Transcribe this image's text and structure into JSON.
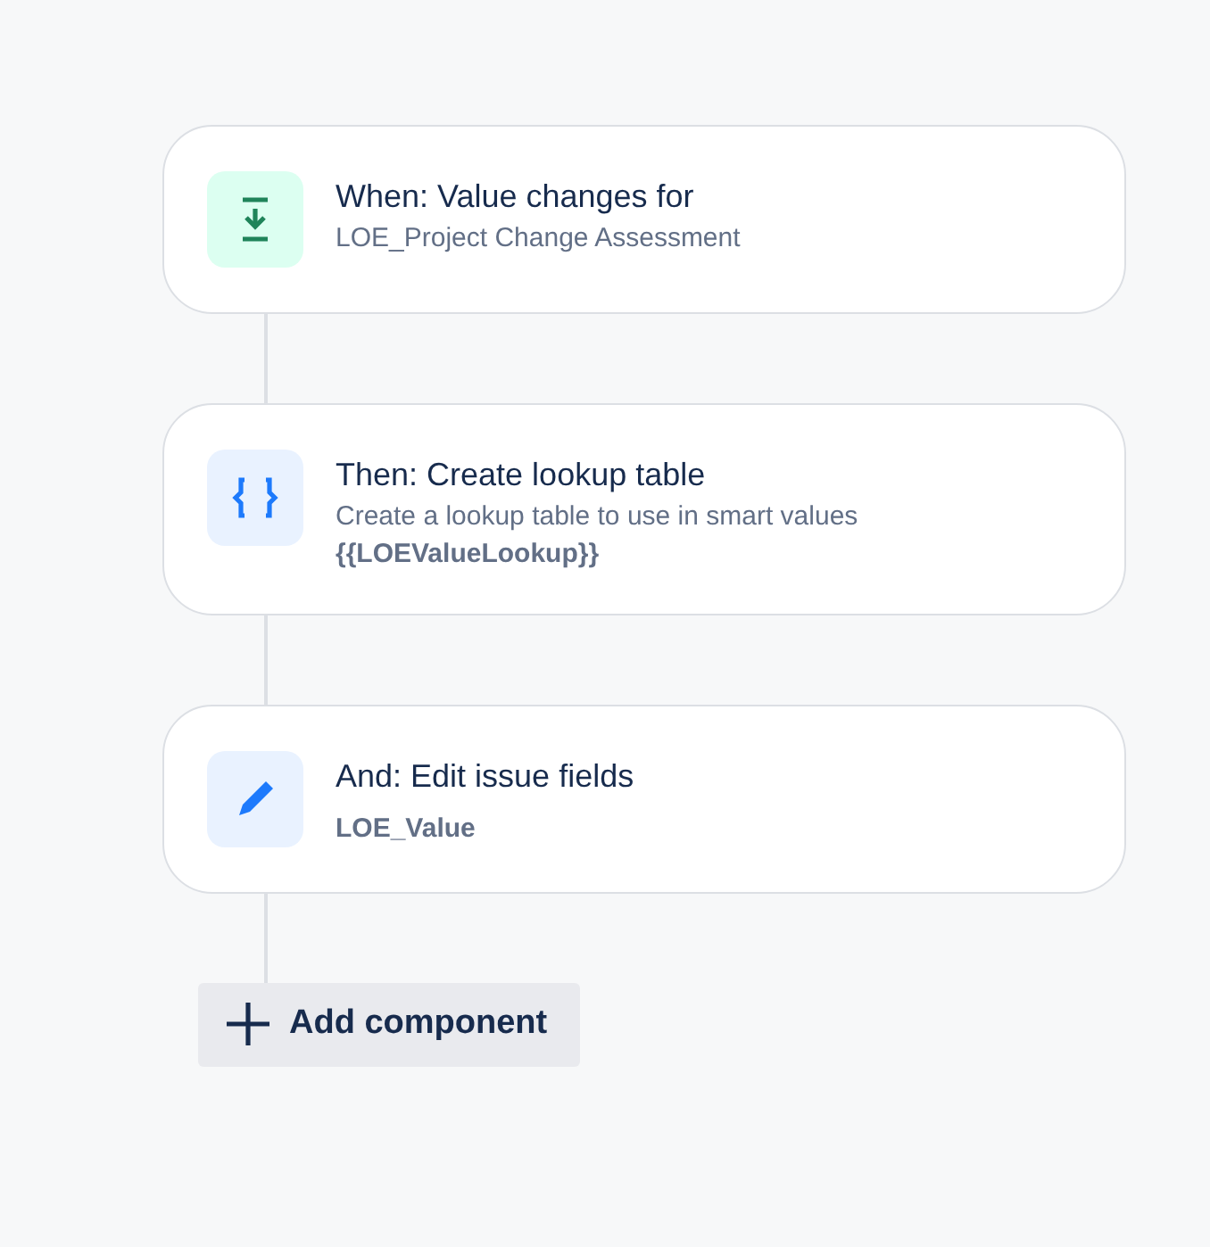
{
  "steps": [
    {
      "kind": "trigger",
      "title": "When: Value changes for",
      "lines": [
        {
          "text": "LOE_Project Change Assessment",
          "bold": false
        }
      ]
    },
    {
      "kind": "lookup",
      "title": "Then: Create lookup table",
      "lines": [
        {
          "text": "Create a lookup table to use in smart values",
          "bold": false
        },
        {
          "text": "{{LOEValueLookup}}",
          "bold": true
        }
      ]
    },
    {
      "kind": "edit",
      "title": "And: Edit issue fields",
      "lines": [
        {
          "text": "LOE_Value",
          "bold": true
        }
      ]
    }
  ],
  "add_button": {
    "label": "Add component"
  }
}
